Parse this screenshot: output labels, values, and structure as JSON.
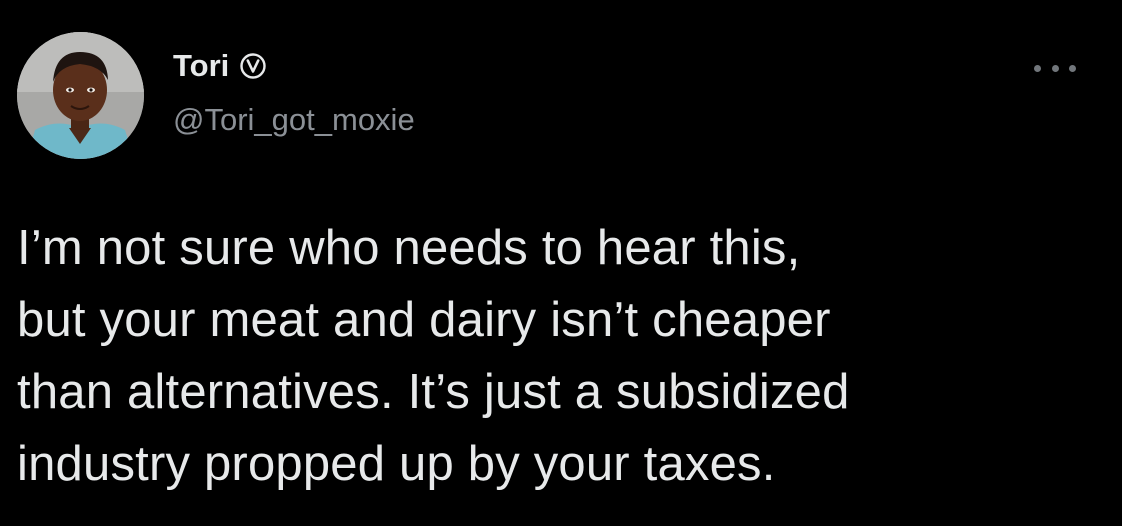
{
  "author": {
    "display_name": "Tori",
    "handle": "@Tori_got_moxie",
    "verified": true
  },
  "icons": {
    "verified": "verified-badge-icon",
    "more": "more-options-icon",
    "avatar": "profile-photo"
  },
  "tweet": {
    "lines": [
      "I’m not sure who needs to hear this,",
      "but your meat and dairy isn’t cheaper",
      "than alternatives. It’s just a subsidized",
      "industry propped up by your taxes."
    ]
  },
  "colors": {
    "background": "#000000",
    "text": "#e7e9ea",
    "secondary_text": "#8b9096"
  }
}
